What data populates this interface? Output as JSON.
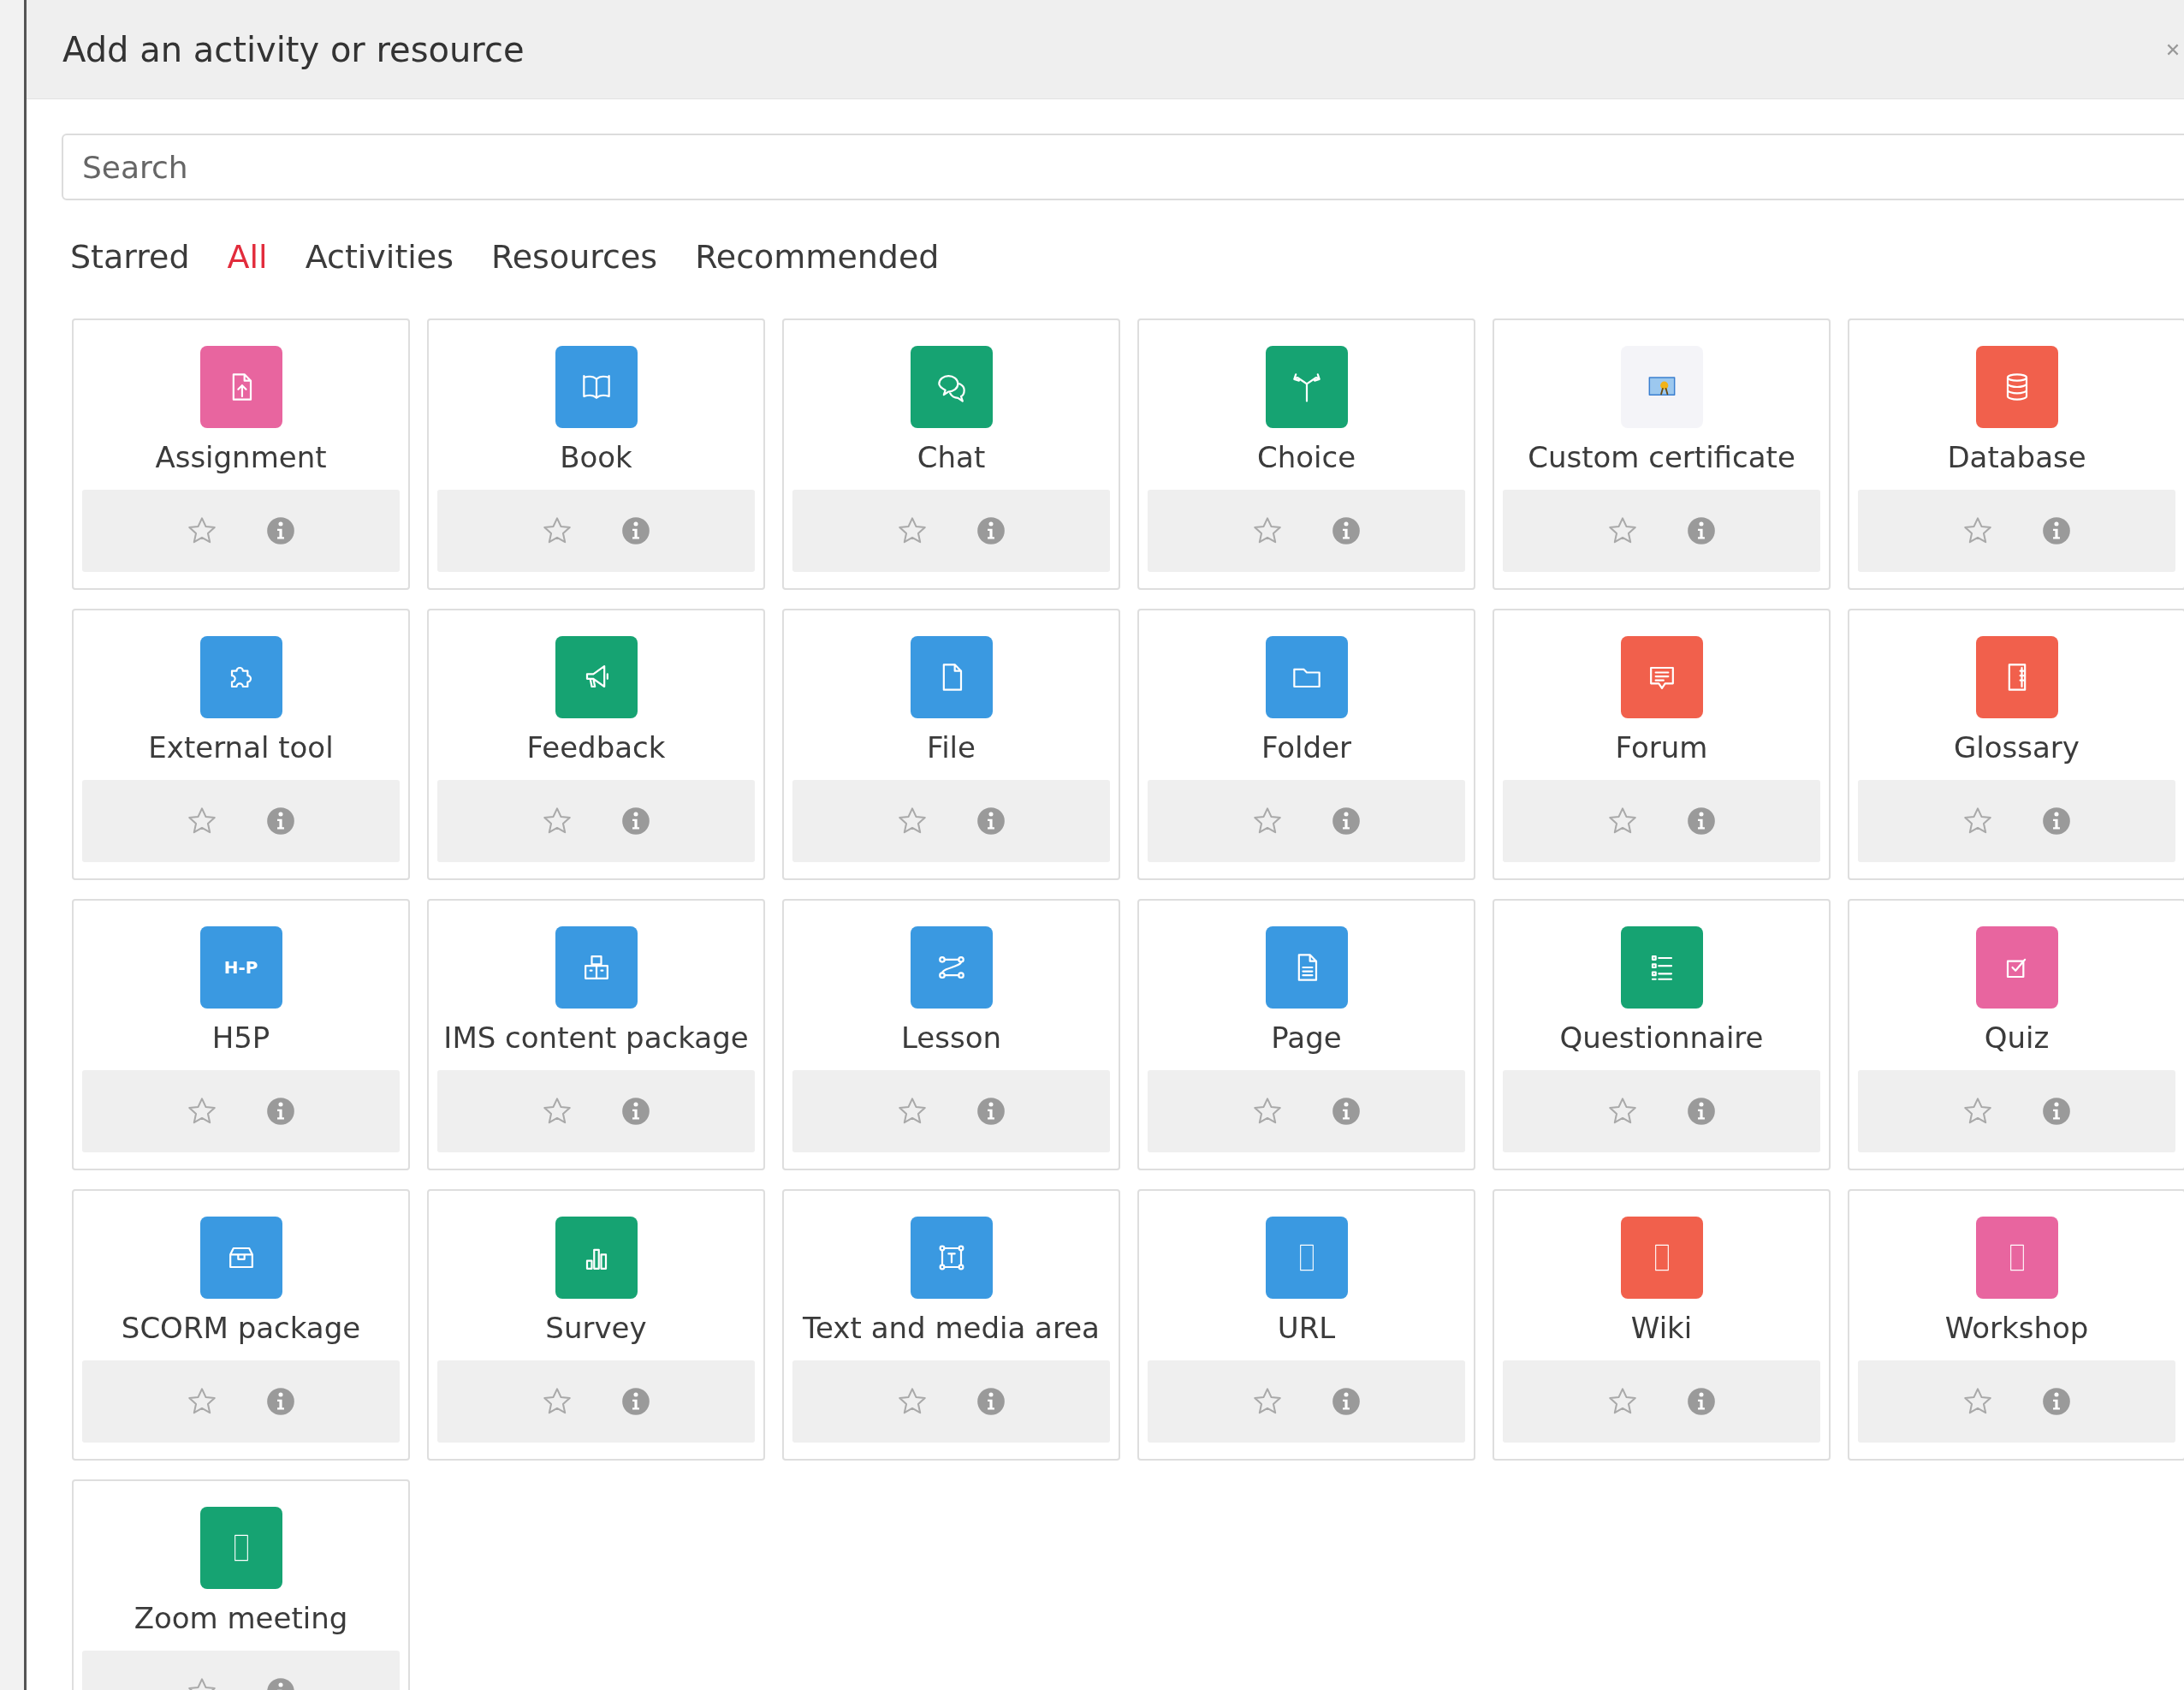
{
  "dialog": {
    "title": "Add an activity or resource"
  },
  "search": {
    "placeholder": "Search"
  },
  "tabs": [
    {
      "label": "Starred",
      "selected": false
    },
    {
      "label": "All",
      "selected": true
    },
    {
      "label": "Activities",
      "selected": false
    },
    {
      "label": "Resources",
      "selected": false
    },
    {
      "label": "Recommended",
      "selected": false
    }
  ],
  "items": [
    {
      "name": "Assignment",
      "kind": "upload",
      "color": "#e8659f",
      "starred": false
    },
    {
      "name": "Book",
      "kind": "book",
      "color": "#3a99e1",
      "starred": false
    },
    {
      "name": "Chat",
      "kind": "chat",
      "color": "#16a372",
      "starred": false
    },
    {
      "name": "Choice",
      "kind": "signpost",
      "color": "#16a372",
      "starred": false
    },
    {
      "name": "Custom certificate",
      "kind": "certificate",
      "color": "#f4f4f8",
      "starred": false
    },
    {
      "name": "Database",
      "kind": "database",
      "color": "#f1604c",
      "starred": false
    },
    {
      "name": "External tool",
      "kind": "puzzle",
      "color": "#3a99e1",
      "starred": false
    },
    {
      "name": "Feedback",
      "kind": "megaphone",
      "color": "#16a372",
      "starred": false
    },
    {
      "name": "File",
      "kind": "file",
      "color": "#3a99e1",
      "starred": false
    },
    {
      "name": "Folder",
      "kind": "folder",
      "color": "#3a99e1",
      "starred": false
    },
    {
      "name": "Forum",
      "kind": "message",
      "color": "#f1604c",
      "starred": false
    },
    {
      "name": "Glossary",
      "kind": "notebook",
      "color": "#f1604c",
      "starred": false
    },
    {
      "name": "H5P",
      "kind": "logo",
      "icon_text": "H-P",
      "color": "#3a99e1",
      "starred": false
    },
    {
      "name": "IMS content package",
      "kind": "boxes",
      "color": "#3a99e1",
      "starred": false
    },
    {
      "name": "Lesson",
      "kind": "route",
      "color": "#3a99e1",
      "starred": false
    },
    {
      "name": "Page",
      "kind": "page",
      "color": "#3a99e1",
      "starred": false
    },
    {
      "name": "Questionnaire",
      "kind": "list",
      "color": "#16a372",
      "starred": false
    },
    {
      "name": "Quiz",
      "kind": "checkbox",
      "color": "#e8659f",
      "starred": false
    },
    {
      "name": "SCORM package",
      "kind": "box",
      "color": "#3a99e1",
      "starred": false
    },
    {
      "name": "Survey",
      "kind": "bars",
      "color": "#16a372",
      "starred": false
    },
    {
      "name": "Text and media area",
      "kind": "textframe",
      "color": "#3a99e1",
      "starred": false
    },
    {
      "name": "URL",
      "kind": "blank",
      "color": "#3a99e1",
      "starred": false
    },
    {
      "name": "Wiki",
      "kind": "blank",
      "color": "#f1604c",
      "starred": false
    },
    {
      "name": "Workshop",
      "kind": "blank",
      "color": "#e8659f",
      "starred": false
    },
    {
      "name": "Zoom meeting",
      "kind": "blank",
      "color": "#16a372",
      "starred": false
    }
  ]
}
